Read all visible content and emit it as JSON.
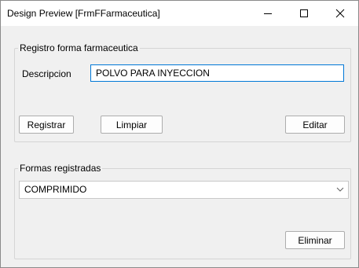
{
  "window": {
    "title": "Design Preview [FrmFFarmaceutica]"
  },
  "registro_group": {
    "legend": "Registro forma farmaceutica",
    "descripcion_label": "Descripcion",
    "descripcion_value": "POLVO PARA INYECCION",
    "registrar_label": "Registrar",
    "limpiar_label": "Limpiar",
    "editar_label": "Editar"
  },
  "formas_group": {
    "legend": "Formas registradas",
    "selected_option": "COMPRIMIDO",
    "eliminar_label": "Eliminar"
  },
  "colors": {
    "focus_border": "#0078d7",
    "window_bg": "#f0f0f0"
  }
}
